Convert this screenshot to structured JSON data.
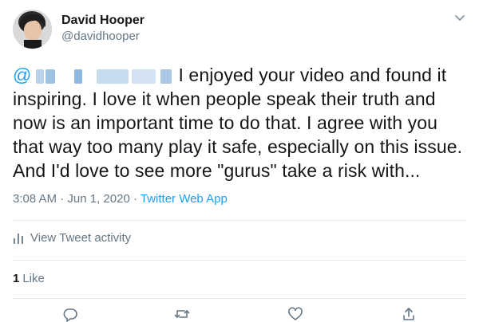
{
  "author": {
    "name": "David Hooper",
    "handle": "@davidhooper"
  },
  "tweet": {
    "mention_prefix": "@",
    "text": "I enjoyed your video and found it inspiring. I love it when people speak their truth and now is an important time to do that. I agree with you that way too many play it safe, especially on this issue. And I'd love to see more \"gurus\" take a risk with..."
  },
  "meta": {
    "time": "3:08 AM",
    "separator": " · ",
    "date": "Jun 1, 2020",
    "source": "Twitter Web App"
  },
  "activity": {
    "label": "View Tweet activity"
  },
  "engagement": {
    "like_count": "1",
    "like_label": "Like"
  },
  "colors": {
    "accent": "#1da1f2",
    "secondary_text": "#657786",
    "divider": "#e6ecf0"
  },
  "icons": {
    "menu": "chevron-down-icon",
    "activity": "bar-chart-icon",
    "reply": "reply-icon",
    "retweet": "retweet-icon",
    "like": "heart-icon",
    "share": "share-icon"
  }
}
